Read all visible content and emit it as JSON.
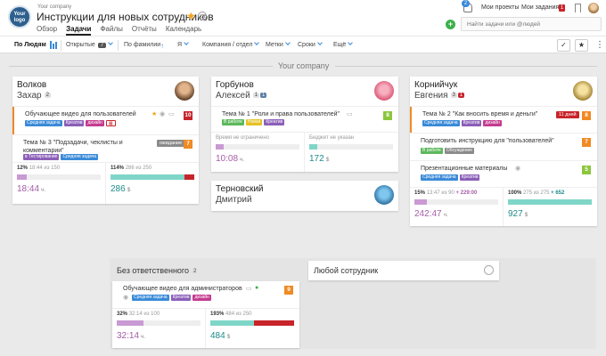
{
  "header": {
    "logo_text": "Your\nlogo",
    "company": "Your company",
    "title": "Инструкции для новых сотрудников",
    "tabs": [
      {
        "label": "Обзор",
        "active": false
      },
      {
        "label": "Задачи",
        "active": true
      },
      {
        "label": "Файлы",
        "active": false
      },
      {
        "label": "Отчёты",
        "active": false
      },
      {
        "label": "Календарь",
        "active": false
      }
    ],
    "notifications_count": "2",
    "my_projects": "Мои проекты",
    "my_tasks": "Мои задания",
    "my_tasks_count": "1",
    "search_placeholder": "Найти задачи или @людей"
  },
  "filters": {
    "group_by": "По Людям",
    "status": "Открытые",
    "status_count": "7",
    "sort": "По фамилии",
    "owner": "Я",
    "company": "Компания / отдел",
    "tags": "Метки",
    "deadlines": "Сроки",
    "more": "Ещё"
  },
  "section": {
    "title": "Your company"
  },
  "colors": {
    "orange": "#f08a24",
    "red": "#c8242b",
    "green_prio": "#8cc63e",
    "tag_blue": "#3a8ad8",
    "tag_purple": "#8b5fb8",
    "tag_magenta": "#c43b8f",
    "tag_gray": "#8a8a8a",
    "tag_green": "#5cb85c",
    "tag_yellow": "#e5c125",
    "time_color": "#a55ca8",
    "budget_color": "#1e8a8a"
  },
  "people": [
    {
      "first": "Волков",
      "last": "Захар",
      "count": "2",
      "tasks": [
        {
          "title": "Обучающее видео для пользователей",
          "prio": "10",
          "tags": [
            "Средняя задача",
            "Креатив",
            "дизайн"
          ]
        },
        {
          "title": "Тема № 3 \"Подзадачи, чеклисты и комментарии\"",
          "deadline": "ожидание",
          "prio": "7",
          "tags": [
            "в Тестирование",
            "Средняя задача"
          ]
        }
      ],
      "time": {
        "pct": "12%",
        "detail": "18:44 из 150",
        "value": "18:44",
        "unit": "ч.",
        "fill": 0.12
      },
      "budget": {
        "pct": "114%",
        "detail": "286 из 250",
        "value": "286",
        "unit": "$",
        "fill": 0.88,
        "over": 0.12
      }
    },
    {
      "first": "Горбунов",
      "last": "Алексей",
      "count": "1",
      "count2": "1",
      "tasks": [
        {
          "title": "Тема № 1 \"Роли и права пользователей\"",
          "prio": "8",
          "tags": [
            "В работе",
            "Новая",
            "Креатив"
          ]
        }
      ],
      "time": {
        "label": "Время не ограничено",
        "value": "10:08",
        "unit": "ч.",
        "fill": 0.1
      },
      "budget": {
        "label": "Бюджет не указан",
        "value": "172",
        "unit": "$",
        "fill": 0.1
      }
    },
    {
      "first": "Терновский",
      "last": "Дмитрий"
    },
    {
      "first": "Корнийчук",
      "last": "Евгения",
      "count": "3",
      "count2": "1",
      "tasks": [
        {
          "title": "Тема № 2 \"Как вносить время и деньги\"",
          "deadline": "11 дней",
          "prio": "8",
          "tags": [
            "Средняя задача",
            "Креатив",
            "дизайн"
          ]
        },
        {
          "title": "Подготовить инструкцию для \"пользователей\"",
          "prio": "7",
          "tags": [
            "В работе",
            "Обсуждение"
          ]
        },
        {
          "title": "Презентационные материалы",
          "prio": "5",
          "tags": [
            "Средняя задача",
            "Креатив"
          ]
        }
      ],
      "time": {
        "pct": "15%",
        "detail": "13:47 из 90",
        "plus": "+ 229:00",
        "value": "242:47",
        "unit": "ч.",
        "fill": 0.15
      },
      "budget": {
        "pct": "100%",
        "detail": "275 из 275",
        "plus": "+ 652",
        "value": "927",
        "unit": "$",
        "fill": 1.0
      }
    }
  ],
  "unassigned": {
    "title": "Без ответственного",
    "count": "2",
    "task": {
      "title": "Обучающее видео для администраторов",
      "prio": "9",
      "tags": [
        "Средняя задача",
        "Креатив",
        "дизайн"
      ]
    },
    "time": {
      "pct": "32%",
      "detail": "32:14 из 100",
      "value": "32:14",
      "unit": "ч.",
      "fill": 0.32
    },
    "budget": {
      "pct": "193%",
      "detail": "484 из 250",
      "value": "484",
      "unit": "$",
      "fill": 0.52,
      "over": 0.48
    }
  },
  "anyone": {
    "title": "Любой сотрудник"
  }
}
